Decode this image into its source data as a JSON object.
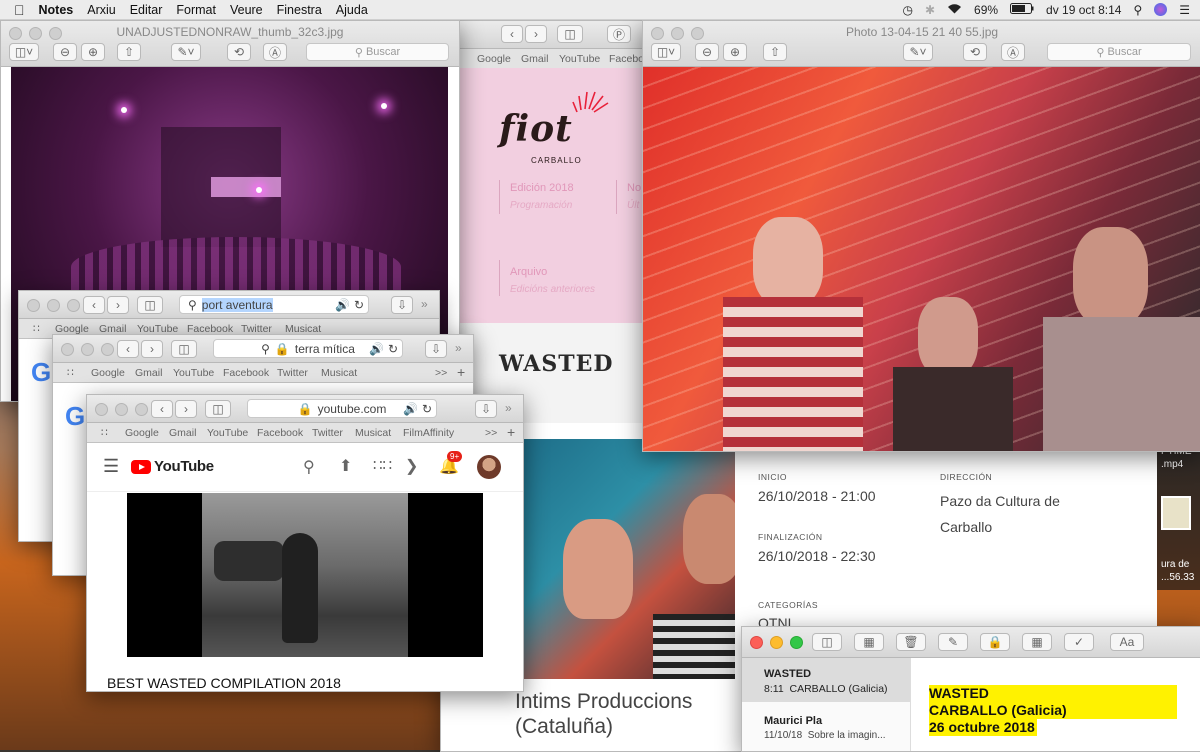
{
  "menubar": {
    "app": "Notes",
    "items": [
      "Arxiu",
      "Editar",
      "Format",
      "Veure",
      "Finestra",
      "Ajuda"
    ],
    "battery": "69%",
    "clock": "dv 19 oct  8:14"
  },
  "preview_left": {
    "title": "UNADJUSTEDNONRAW_thumb_32c3.jpg",
    "search_placeholder": "Buscar"
  },
  "preview_right": {
    "title": "Photo 13-04-15 21 40 55.jpg",
    "search_placeholder": "Buscar"
  },
  "fiot_page": {
    "favorites": [
      "Google",
      "Gmail",
      "YouTube",
      "Faceboo"
    ],
    "logo": "fiot",
    "logo_sub": "CARBALLO",
    "nav": [
      {
        "label": "Edición 2018",
        "sub": "Programación"
      },
      {
        "label": "No",
        "sub": "Últ"
      },
      {
        "label": "Arquivo",
        "sub": "Edicións anteriores"
      }
    ],
    "event_title": "WASTED",
    "inicio_label": "INICIO",
    "inicio_value": "26/10/2018 - 21:00",
    "direccion_label": "DIRECCIÓN",
    "direccion_line1": "Pazo da Cultura de",
    "direccion_line2": "Carballo",
    "fin_label": "FINALIZACIÓN",
    "fin_value": "26/10/2018 - 22:30",
    "categorias_label": "CATEGORÍAS",
    "categorias_value": "OTNI",
    "org_line1": "Íntims Produccions",
    "org_line2": "(Cataluña)"
  },
  "safari1": {
    "url": "port aventura",
    "favorites": [
      "Google",
      "Gmail",
      "YouTube",
      "Facebook",
      "Twitter",
      "Musicat"
    ],
    "logo_letter": "G"
  },
  "safari2": {
    "url": "terra mítica",
    "favorites": [
      "Google",
      "Gmail",
      "YouTube",
      "Facebook",
      "Twitter",
      "Musicat"
    ],
    "logo_letter": "G"
  },
  "safari3": {
    "url": "youtube.com",
    "favorites": [
      "Google",
      "Gmail",
      "YouTube",
      "Facebook",
      "Twitter",
      "Musicat",
      "FilmAffinity"
    ],
    "brand": "YouTube",
    "notif_badge": "9+",
    "video_title": "BEST WASTED COMPILATION 2018",
    "brand_color": "#ff0000"
  },
  "desktop_icons": {
    "line1": "PTIME",
    "line2": ".mp4",
    "line3": "ura de",
    "line4": "...56.33"
  },
  "notes": {
    "list": [
      {
        "title": "WASTED",
        "time": "8:11",
        "preview": "CARBALLO (Galicia)"
      },
      {
        "title": "Maurici Pla",
        "time": "11/10/18",
        "preview": "Sobre la imagin..."
      }
    ],
    "body": [
      "WASTED",
      "CARBALLO (Galicia)",
      "26 octubre 2018"
    ],
    "highlight_color": "#fff200"
  }
}
